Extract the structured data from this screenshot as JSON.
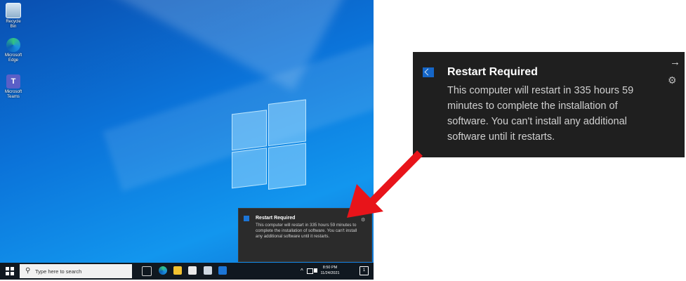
{
  "desktop": {
    "icons": [
      {
        "label": "Recycle Bin",
        "icon": "recycle-bin-icon"
      },
      {
        "label": "Microsoft Edge",
        "icon": "edge-icon"
      },
      {
        "label": "Microsoft Teams",
        "icon": "teams-icon"
      }
    ]
  },
  "toast": {
    "title": "Restart Required",
    "body": "This computer will restart in 335 hours 59 minutes to complete the installation of software. You can't install any additional software until it restarts.",
    "arrow_glyph": "→",
    "gear_glyph": "⚙"
  },
  "taskbar": {
    "search_placeholder": "Type here to search",
    "time": "8:50 PM",
    "date": "11/24/2021",
    "tray_chevron": "^"
  },
  "colors": {
    "annotation_arrow": "#e8141a",
    "toast_background": "#1f1f1f",
    "taskbar_background": "#101820"
  }
}
